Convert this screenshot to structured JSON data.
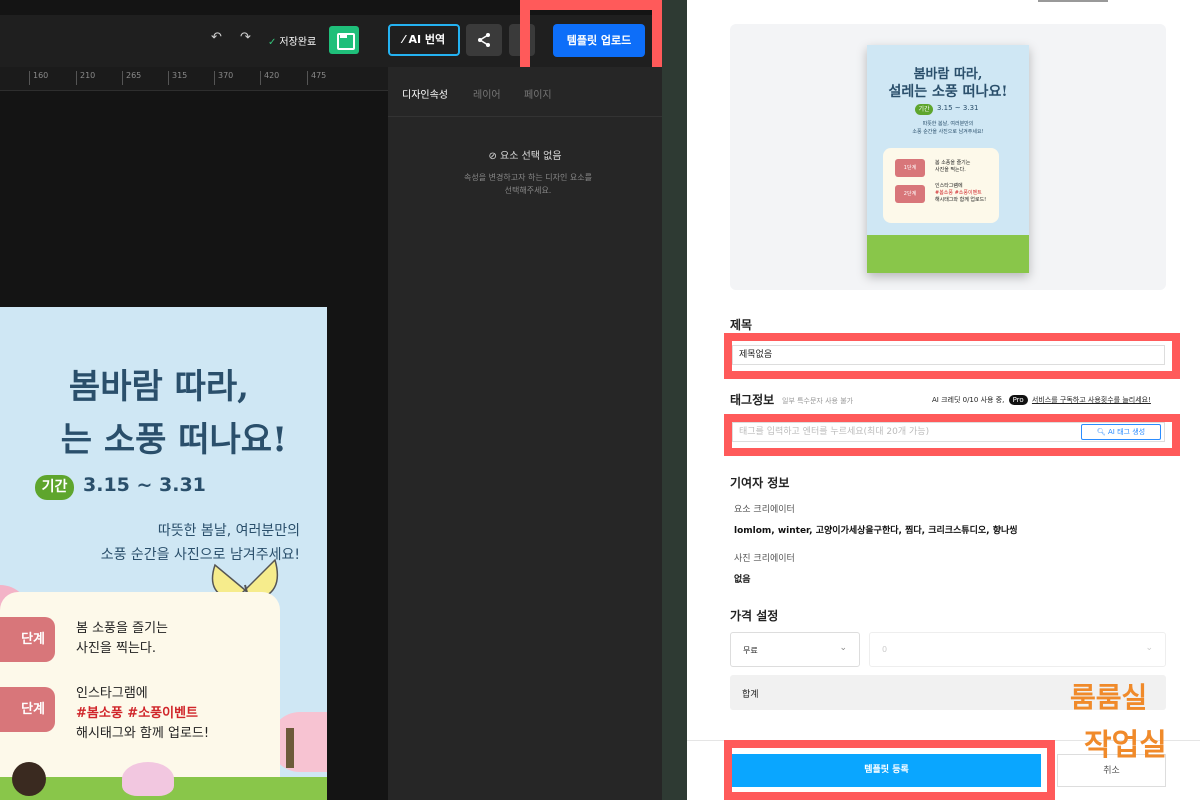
{
  "toolbar": {
    "undo": "↶",
    "redo": "↷",
    "save_status": "저장완료",
    "ai_translate": "AI 번역",
    "upload_template": "템플릿 업로드"
  },
  "ruler": [
    "160",
    "210",
    "265",
    "315",
    "370",
    "420",
    "475"
  ],
  "props_panel": {
    "tabs": [
      "디자인속성",
      "레이어",
      "페이지"
    ],
    "no_selection": "요소 선택 없음",
    "no_selection_desc_1": "속성을 변경하고자 하는 디자인 요소를",
    "no_selection_desc_2": "선택해주세요."
  },
  "poster": {
    "title_1": "봄바람 따라,",
    "title_2": "는 소풍 떠나요!",
    "period_badge": "기간",
    "period": "3.15 ~ 3.31",
    "desc_1": "따뜻한 봄날, 여러분만의",
    "desc_2": "소풍 순간을 사진으로 남겨주세요!",
    "step_1": "단계",
    "step_1_text_1": "봄 소풍을 즐기는",
    "step_1_text_2": "사진을 찍는다.",
    "step_2": "단계",
    "step_2_text_1": "인스타그램에",
    "step_2_tags": "#봄소풍 #소풍이벤트",
    "step_2_text_3": "해시태그와 함께 업로드!"
  },
  "thumbnail": {
    "title_1": "봄바람 따라,",
    "title_2": "설레는 소풍 떠나요!",
    "period_badge": "기간",
    "period": "3.15 ~ 3.31",
    "desc_1": "따뜻한 봄날, 여러분만의",
    "desc_2": "소풍 순간을 사진으로 남겨주세요!",
    "step_1": "1단계",
    "step_1_text_1": "봄 소풍을 즐기는",
    "step_1_text_2": "사진을 찍는다.",
    "step_2": "2단계",
    "step_2_text_1": "인스타그램에",
    "step_2_tags": "#봄소풍 #소풍이벤트",
    "step_2_text_3": "해시태그와 함께 업로드!"
  },
  "form": {
    "title_label": "제목",
    "title_value": "제목없음",
    "tag_label": "태그정보",
    "tag_note": "일부 특수문자 사용 불가",
    "credit_prefix": "AI 크레딧 0/10 사용 중,",
    "pro_badge": "Pro",
    "credit_link": "서비스를 구독하고 사용횟수를 늘리세요!",
    "tag_placeholder": "태그를 입력하고 엔터를 누르세요(최대 20개 가능)",
    "ai_tag_button": "AI 태그 생성",
    "contributor_label": "기여자 정보",
    "element_creator_label": "요소 크리에이터",
    "element_creators": "lomlom, winter, 고양이가세상을구한다, 찜다, 크리크스튜디오, 향나씽",
    "photo_creator_label": "사진 크리에이터",
    "photo_creators": "없음",
    "price_label": "가격 설정",
    "price_type": "무료",
    "price_value": "0",
    "sum_label": "합계",
    "register_button": "템플릿 등록",
    "cancel_button": "취소"
  },
  "watermark": {
    "line_1": "룸룸실",
    "line_2": "작업실"
  },
  "colors": {
    "upload_blue": "#0d6ef9",
    "highlight_red": "#ff5a5a",
    "register_blue": "#0aa6ff",
    "save_green": "#1fbf7a"
  }
}
